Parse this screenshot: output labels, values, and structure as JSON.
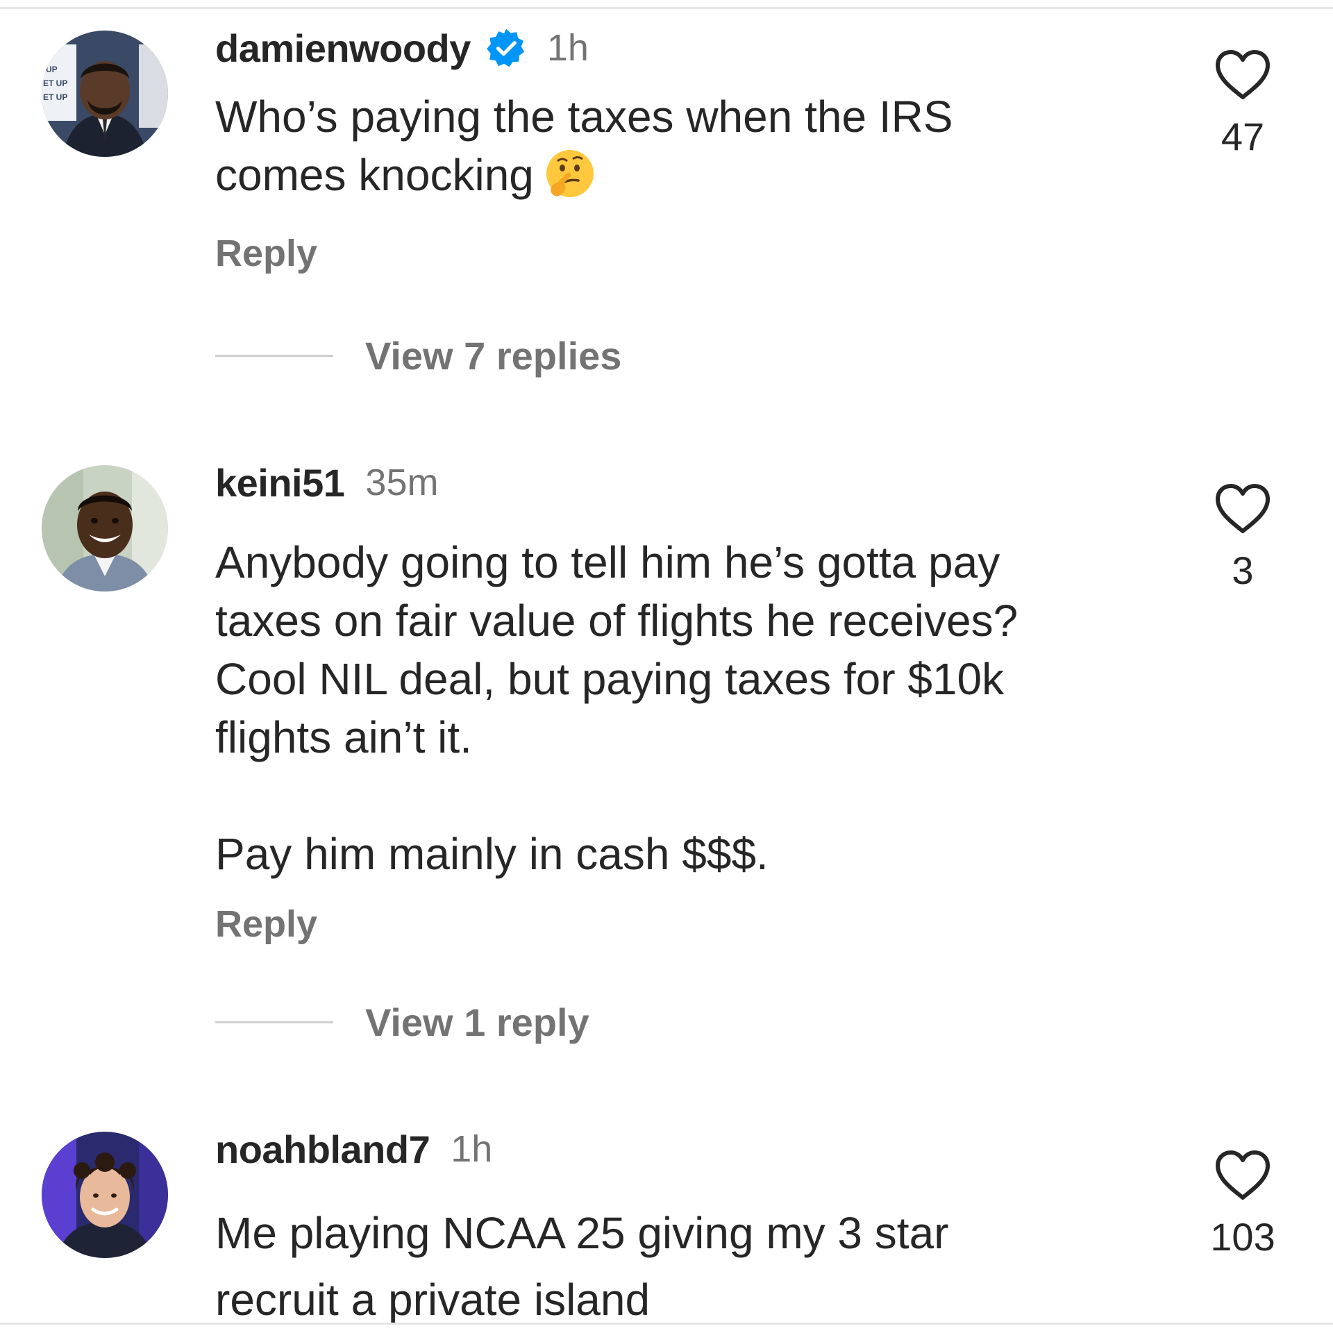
{
  "comments": [
    {
      "username": "damienwoody",
      "verified": true,
      "time": "1h",
      "lines": [
        "Who’s paying the taxes when the IRS",
        "comes knocking"
      ],
      "emoji": "thinking-face-emoji",
      "reply_label": "Reply",
      "view_replies": "View 7 replies",
      "likes": "47"
    },
    {
      "username": "keini51",
      "verified": false,
      "time": "35m",
      "lines": [
        "Anybody going to tell him he’s gotta pay",
        "taxes on fair value of flights he receives?",
        "Cool NIL deal, but paying taxes for $10k",
        "flights ain’t it."
      ],
      "extra_paragraph": "Pay him mainly in cash $$$.",
      "reply_label": "Reply",
      "view_replies": "View 1 reply",
      "likes": "3"
    },
    {
      "username": "noahbland7",
      "verified": false,
      "time": "1h",
      "lines": [
        "Me playing NCAA 25 giving my 3 star",
        "recruit a private island"
      ],
      "likes": "103"
    }
  ],
  "colors": {
    "text": "#262626",
    "secondary": "#737373",
    "verified_blue": "#0095f6",
    "divider": "#cfcfcf"
  },
  "icons": {
    "like": "heart-outline-icon",
    "verified": "verified-badge-icon"
  }
}
